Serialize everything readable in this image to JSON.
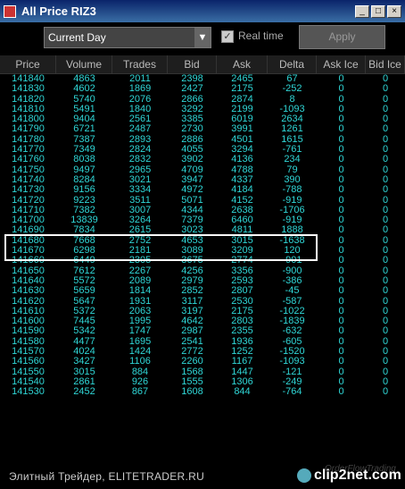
{
  "window": {
    "title": "All Price RIZ3"
  },
  "toolbar": {
    "period_value": "Current Day",
    "realtime_label": "Real time",
    "apply_label": "Apply"
  },
  "columns": [
    "Price",
    "Volume",
    "Trades",
    "Bid",
    "Ask",
    "Delta",
    "Ask Ice",
    "Bid Ice"
  ],
  "rows": [
    [
      "141840",
      "4863",
      "2011",
      "2398",
      "2465",
      "67",
      "0",
      "0"
    ],
    [
      "141830",
      "4602",
      "1869",
      "2427",
      "2175",
      "-252",
      "0",
      "0"
    ],
    [
      "141820",
      "5740",
      "2076",
      "2866",
      "2874",
      "8",
      "0",
      "0"
    ],
    [
      "141810",
      "5491",
      "1840",
      "3292",
      "2199",
      "-1093",
      "0",
      "0"
    ],
    [
      "141800",
      "9404",
      "2561",
      "3385",
      "6019",
      "2634",
      "0",
      "0"
    ],
    [
      "141790",
      "6721",
      "2487",
      "2730",
      "3991",
      "1261",
      "0",
      "0"
    ],
    [
      "141780",
      "7387",
      "2893",
      "2886",
      "4501",
      "1615",
      "0",
      "0"
    ],
    [
      "141770",
      "7349",
      "2824",
      "4055",
      "3294",
      "-761",
      "0",
      "0"
    ],
    [
      "141760",
      "8038",
      "2832",
      "3902",
      "4136",
      "234",
      "0",
      "0"
    ],
    [
      "141750",
      "9497",
      "2965",
      "4709",
      "4788",
      "79",
      "0",
      "0"
    ],
    [
      "141740",
      "8284",
      "3021",
      "3947",
      "4337",
      "390",
      "0",
      "0"
    ],
    [
      "141730",
      "9156",
      "3334",
      "4972",
      "4184",
      "-788",
      "0",
      "0"
    ],
    [
      "141720",
      "9223",
      "3511",
      "5071",
      "4152",
      "-919",
      "0",
      "0"
    ],
    [
      "141710",
      "7382",
      "3007",
      "4344",
      "2638",
      "-1706",
      "0",
      "0"
    ],
    [
      "141700",
      "13839",
      "3264",
      "7379",
      "6460",
      "-919",
      "0",
      "0"
    ],
    [
      "141690",
      "7834",
      "2615",
      "3023",
      "4811",
      "1888",
      "0",
      "0"
    ],
    [
      "141680",
      "7668",
      "2752",
      "4653",
      "3015",
      "-1638",
      "0",
      "0"
    ],
    [
      "141670",
      "6298",
      "2181",
      "3089",
      "3209",
      "120",
      "0",
      "0"
    ],
    [
      "141660",
      "6449",
      "2305",
      "3675",
      "2774",
      "-901",
      "0",
      "0"
    ],
    [
      "141650",
      "7612",
      "2267",
      "4256",
      "3356",
      "-900",
      "0",
      "0"
    ],
    [
      "141640",
      "5572",
      "2089",
      "2979",
      "2593",
      "-386",
      "0",
      "0"
    ],
    [
      "141630",
      "5659",
      "1814",
      "2852",
      "2807",
      "-45",
      "0",
      "0"
    ],
    [
      "141620",
      "5647",
      "1931",
      "3117",
      "2530",
      "-587",
      "0",
      "0"
    ],
    [
      "141610",
      "5372",
      "2063",
      "3197",
      "2175",
      "-1022",
      "0",
      "0"
    ],
    [
      "141600",
      "7445",
      "1995",
      "4642",
      "2803",
      "-1839",
      "0",
      "0"
    ],
    [
      "141590",
      "5342",
      "1747",
      "2987",
      "2355",
      "-632",
      "0",
      "0"
    ],
    [
      "141580",
      "4477",
      "1695",
      "2541",
      "1936",
      "-605",
      "0",
      "0"
    ],
    [
      "141570",
      "4024",
      "1424",
      "2772",
      "1252",
      "-1520",
      "0",
      "0"
    ],
    [
      "141560",
      "3427",
      "1106",
      "2260",
      "1167",
      "-1093",
      "0",
      "0"
    ],
    [
      "141550",
      "3015",
      "884",
      "1568",
      "1447",
      "-121",
      "0",
      "0"
    ],
    [
      "141540",
      "2861",
      "926",
      "1555",
      "1306",
      "-249",
      "0",
      "0"
    ],
    [
      "141530",
      "2452",
      "867",
      "1608",
      "844",
      "-764",
      "0",
      "0"
    ]
  ],
  "footer": {
    "text": "Элитный Трейдер, ELITETRADER.RU",
    "watermark": "OrderFlowTrading",
    "logo": "clip2net.com"
  }
}
